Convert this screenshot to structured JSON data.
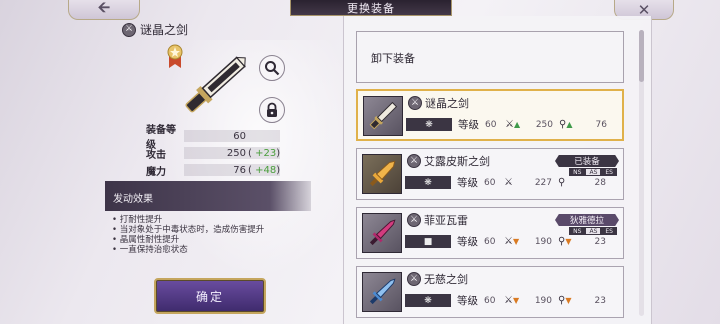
{
  "header": {
    "title": "更换装备",
    "back_icon": "arrow-left-icon",
    "close_icon": "close-x-icon"
  },
  "selected_item": {
    "name": "谜晶之剑",
    "stats": [
      {
        "label": "装备等级",
        "value": "60",
        "bonus": ""
      },
      {
        "label": "攻击",
        "value": "250",
        "bonus": "+23"
      },
      {
        "label": "魔力",
        "value": "76",
        "bonus": "+48"
      }
    ],
    "effect_title": "发动效果",
    "effects": [
      "• 打耐性提升",
      "• 当对象处于中毒状态时，造成伤害提升",
      "• 晶属性耐性提升",
      "• 一直保持治愈状态"
    ],
    "confirm_label": "确定"
  },
  "equipment_list": {
    "unequip_label": "卸下装备",
    "items": [
      {
        "name": "谜晶之剑",
        "level_label": "等级",
        "level": "60",
        "attack": "250",
        "attack_trend": "up",
        "magic": "76",
        "magic_trend": "up",
        "equipped_tag": "",
        "owner": "",
        "selected": true
      },
      {
        "name": "艾露皮斯之剑",
        "level_label": "等级",
        "level": "60",
        "attack": "227",
        "attack_trend": "none",
        "magic": "28",
        "magic_trend": "none",
        "equipped_tag": "已装备",
        "owner": "",
        "selected": false
      },
      {
        "name": "菲亚瓦雷",
        "level_label": "等级",
        "level": "60",
        "attack": "190",
        "attack_trend": "down",
        "magic": "23",
        "magic_trend": "down",
        "equipped_tag": "狄雅德拉",
        "owner": "person",
        "selected": false
      },
      {
        "name": "无慈之剑",
        "level_label": "等级",
        "level": "60",
        "attack": "190",
        "attack_trend": "down",
        "magic": "23",
        "magic_trend": "down",
        "equipped_tag": "",
        "owner": "",
        "selected": false
      }
    ],
    "tag_sub": [
      "NS",
      "AS",
      "ES"
    ]
  },
  "colors": {
    "accent_gold": "#e0b14a",
    "panel_dark": "#3b3543",
    "up_green": "#3f9a4a",
    "down_orange": "#d97a22",
    "bonus_green": "#4a9e3c"
  }
}
